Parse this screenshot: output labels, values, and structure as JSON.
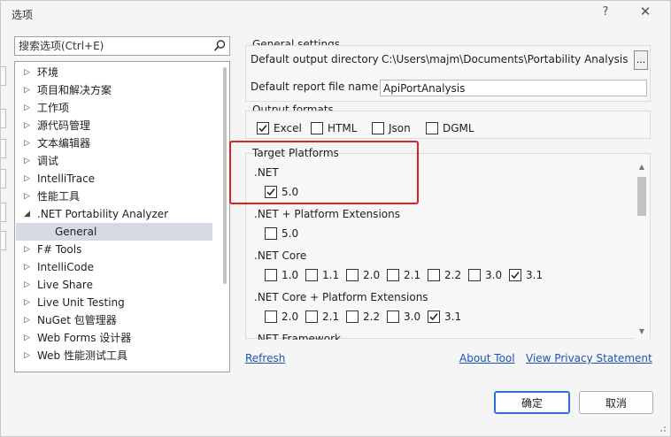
{
  "window": {
    "title": "选项",
    "help_glyph": "?",
    "close_glyph": "✕"
  },
  "search": {
    "placeholder": "搜索选项(Ctrl+E)"
  },
  "tree": {
    "items": [
      {
        "label": "环境",
        "expanded": false
      },
      {
        "label": "项目和解决方案",
        "expanded": false
      },
      {
        "label": "工作项",
        "expanded": false
      },
      {
        "label": "源代码管理",
        "expanded": false
      },
      {
        "label": "文本编辑器",
        "expanded": false
      },
      {
        "label": "调试",
        "expanded": false
      },
      {
        "label": "IntelliTrace",
        "expanded": false
      },
      {
        "label": "性能工具",
        "expanded": false
      },
      {
        "label": ".NET Portability Analyzer",
        "expanded": true
      },
      {
        "label": "General",
        "child": true,
        "selected": true
      },
      {
        "label": "F# Tools",
        "expanded": false
      },
      {
        "label": "IntelliCode",
        "expanded": false
      },
      {
        "label": "Live Share",
        "expanded": false
      },
      {
        "label": "Live Unit Testing",
        "expanded": false
      },
      {
        "label": "NuGet 包管理器",
        "expanded": false
      },
      {
        "label": "Web Forms 设计器",
        "expanded": false
      },
      {
        "label": "Web 性能测试工具",
        "expanded": false
      }
    ]
  },
  "general_settings": {
    "title": "General settings",
    "output_dir_label": "Default output directory",
    "output_dir_value": "C:\\Users\\majm\\Documents\\Portability Analysis",
    "browse_label": "...",
    "report_name_label": "Default report file name",
    "report_name_value": "ApiPortAnalysis"
  },
  "output_formats": {
    "title": "Output formats",
    "options": [
      {
        "label": "Excel",
        "checked": true
      },
      {
        "label": "HTML",
        "checked": false
      },
      {
        "label": "Json",
        "checked": false
      },
      {
        "label": "DGML",
        "checked": false
      }
    ]
  },
  "target_platforms": {
    "title": "Target Platforms",
    "groups": [
      {
        "name": ".NET",
        "versions": [
          {
            "label": "5.0",
            "checked": true
          }
        ]
      },
      {
        "name": ".NET + Platform Extensions",
        "versions": [
          {
            "label": "5.0",
            "checked": false
          }
        ]
      },
      {
        "name": ".NET Core",
        "versions": [
          {
            "label": "1.0",
            "checked": false
          },
          {
            "label": "1.1",
            "checked": false
          },
          {
            "label": "2.0",
            "checked": false
          },
          {
            "label": "2.1",
            "checked": false
          },
          {
            "label": "2.2",
            "checked": false
          },
          {
            "label": "3.0",
            "checked": false
          },
          {
            "label": "3.1",
            "checked": true
          }
        ]
      },
      {
        "name": ".NET Core + Platform Extensions",
        "versions": [
          {
            "label": "2.0",
            "checked": false
          },
          {
            "label": "2.1",
            "checked": false
          },
          {
            "label": "2.2",
            "checked": false
          },
          {
            "label": "3.0",
            "checked": false
          },
          {
            "label": "3.1",
            "checked": true
          }
        ]
      }
    ],
    "partial_group_name": ".NET Framework"
  },
  "links": {
    "refresh": "Refresh",
    "about": "About Tool",
    "privacy": "View Privacy Statement"
  },
  "buttons": {
    "ok": "确定",
    "cancel": "取消"
  },
  "colors": {
    "highlight": "#e02020",
    "link": "#1a54b6",
    "selected_row": "#d7d9e2",
    "primary_border": "#2e6fd0"
  }
}
